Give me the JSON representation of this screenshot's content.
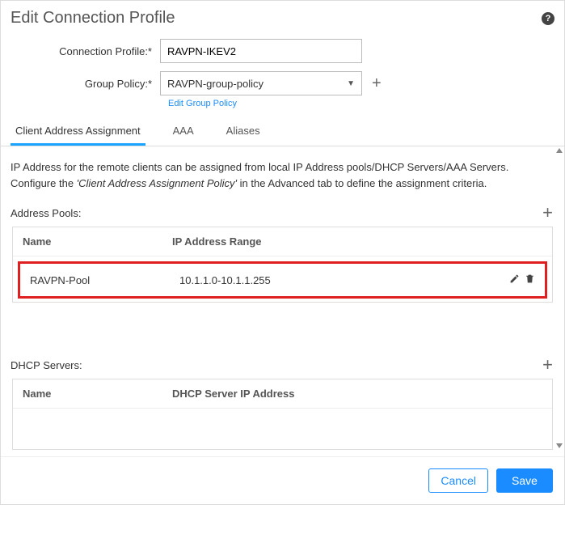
{
  "header": {
    "title": "Edit Connection Profile"
  },
  "form": {
    "connection_profile_label": "Connection Profile:*",
    "connection_profile_value": "RAVPN-IKEV2",
    "group_policy_label": "Group Policy:*",
    "group_policy_value": "RAVPN-group-policy",
    "edit_group_policy_link": "Edit Group Policy"
  },
  "tabs": {
    "items": [
      {
        "label": "Client Address Assignment",
        "active": true
      },
      {
        "label": "AAA",
        "active": false
      },
      {
        "label": "Aliases",
        "active": false
      }
    ]
  },
  "description": {
    "part1": "IP Address for the remote clients can be assigned from local IP Address pools/DHCP Servers/AAA Servers. Configure the ",
    "italic": "'Client Address Assignment Policy'",
    "part2": " in the Advanced tab to define the assignment criteria."
  },
  "address_pools": {
    "section_label": "Address Pools:",
    "columns": {
      "name": "Name",
      "range": "IP Address Range"
    },
    "rows": [
      {
        "name": "RAVPN-Pool",
        "range": "10.1.1.0-10.1.1.255"
      }
    ]
  },
  "dhcp_servers": {
    "section_label": "DHCP Servers:",
    "columns": {
      "name": "Name",
      "ip": "DHCP Server IP Address"
    },
    "rows": []
  },
  "footer": {
    "cancel": "Cancel",
    "save": "Save"
  }
}
